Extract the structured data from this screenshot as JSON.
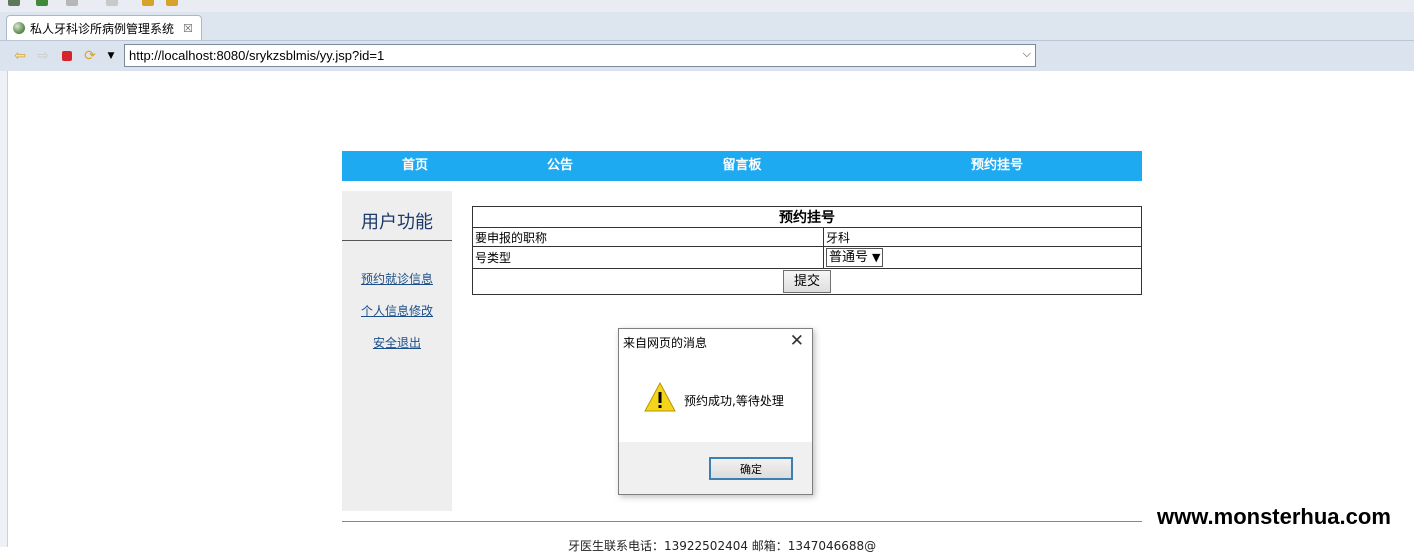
{
  "browser": {
    "tab_title": "私人牙科诊所病例管理系统",
    "tab_close": "☒",
    "url": "http://localhost:8080/srykzsblmis/yy.jsp?id=1"
  },
  "menu": {
    "items": [
      "首页",
      "公告",
      "留言板",
      "预约挂号"
    ]
  },
  "sidebar": {
    "title": "用户功能",
    "links": [
      "预约就诊信息",
      "个人信息修改",
      "安全退出"
    ]
  },
  "form": {
    "caption": "预约挂号",
    "title_label": "要申报的职称",
    "title_value": "牙科",
    "type_label": "号类型",
    "type_value": "普通号",
    "submit_label": "提交"
  },
  "footer": {
    "text": "牙医生联系电话：13922502404 邮箱：1347046688@"
  },
  "dialog": {
    "title": "来自网页的消息",
    "message": "预约成功,等待处理",
    "ok_label": "确定"
  },
  "watermark": "www.monsterhua.com",
  "colors": {
    "menu_bar": "#1eaaf1",
    "sidebar_bg": "#eeeeee",
    "link": "#1a4f8a"
  }
}
